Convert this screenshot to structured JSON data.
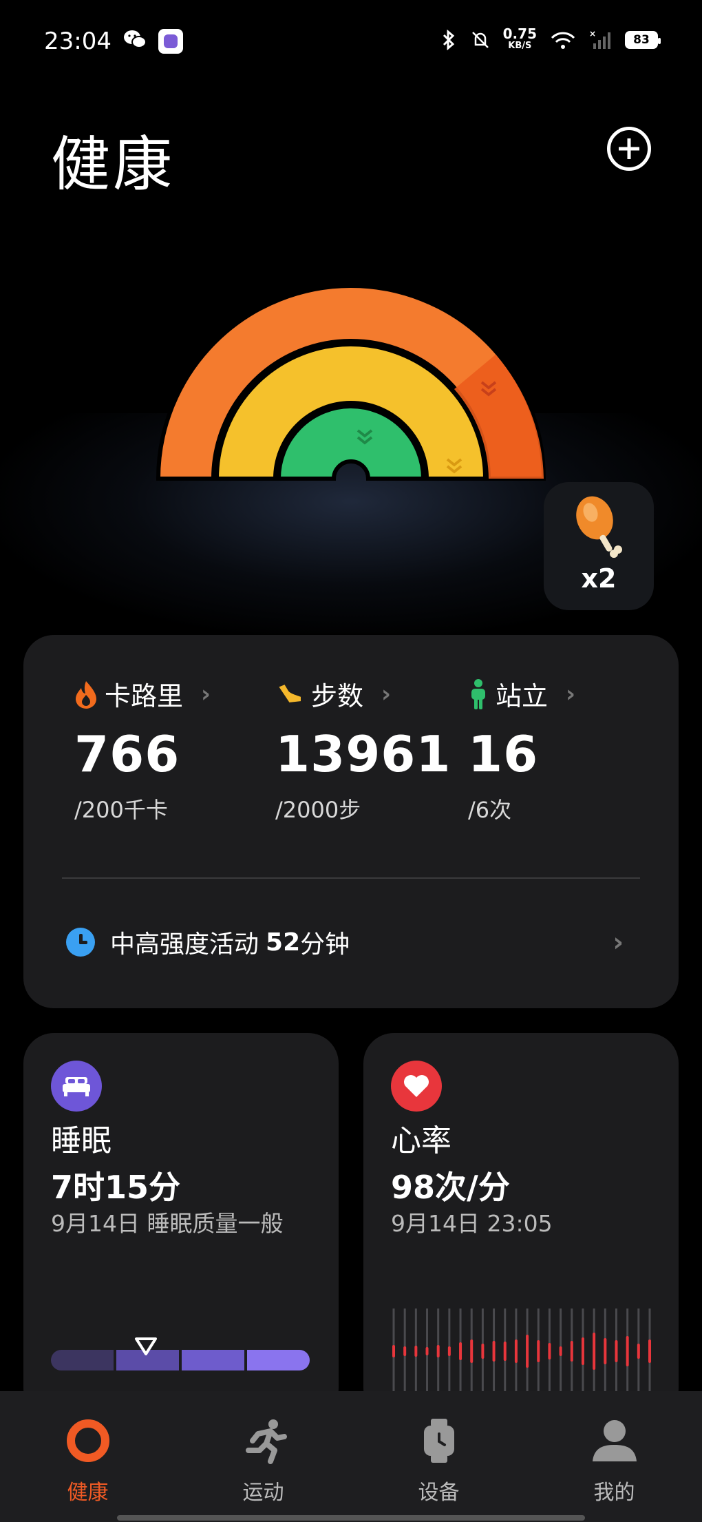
{
  "status_bar": {
    "time": "23:04",
    "net_speed_value": "0.75",
    "net_speed_unit": "KB/S",
    "battery": "83"
  },
  "header": {
    "title": "健康"
  },
  "reward": {
    "count": "x2"
  },
  "stats": {
    "calories": {
      "label": "卡路里",
      "value": "766",
      "goal": "/200千卡"
    },
    "steps": {
      "label": "步数",
      "value": "13961",
      "goal": "/2000步"
    },
    "standing": {
      "label": "站立",
      "value": "16",
      "goal": "/6次"
    }
  },
  "activity": {
    "label": "中高强度活动",
    "value": "52",
    "unit": "分钟"
  },
  "sleep": {
    "title": "睡眠",
    "value": "7时15分",
    "sub": "9月14日 睡眠质量一般"
  },
  "heart": {
    "title": "心率",
    "value": "98次/分",
    "sub": "9月14日 23:05"
  },
  "tabs": [
    {
      "label": "健康"
    },
    {
      "label": "运动"
    },
    {
      "label": "设备"
    },
    {
      "label": "我的"
    }
  ],
  "colors": {
    "outer_ring": "#f47b2e",
    "middle_ring": "#f5c12c",
    "inner_ring": "#2fbf6c",
    "active_tab": "#f05a24"
  }
}
